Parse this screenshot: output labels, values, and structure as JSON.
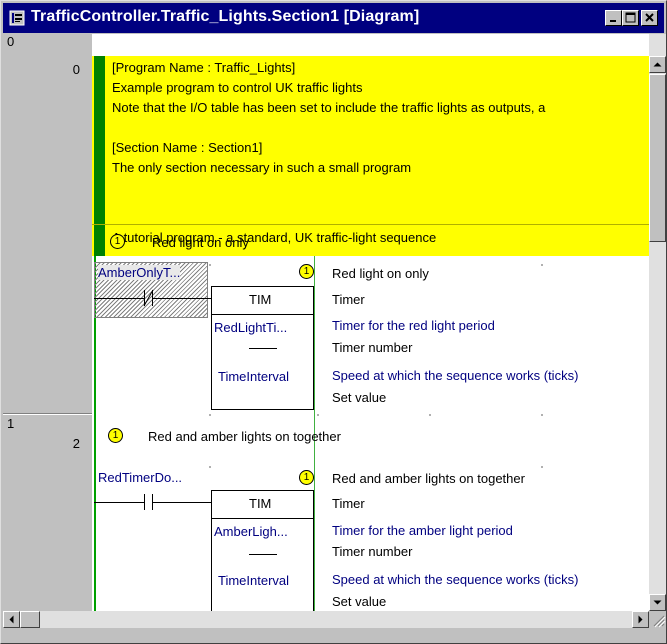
{
  "window": {
    "title": "TrafficController.Traffic_Lights.Section1 [Diagram]"
  },
  "rung_gutter": {
    "rungs": [
      {
        "rung": "0",
        "step": "0"
      },
      {
        "rung": "1",
        "step": "2"
      }
    ]
  },
  "comment_block": {
    "lines": [
      "[Program Name : Traffic_Lights]",
      "Example program to control UK traffic lights",
      "Note that the I/O table has been set to include the traffic lights as outputs, a",
      "",
      "[Section Name : Section1]",
      "The only section necessary in such a small program"
    ],
    "footer": "A tutorial program - a standard, UK traffic-light sequence"
  },
  "rung0": {
    "badge": "1",
    "comment": "Red light on only",
    "contact_name": "AmberOnlyT...",
    "block_type": "TIM",
    "operand1": "RedLightTi...",
    "operand2": "TimeInterval",
    "output_badge": "1",
    "descriptions": {
      "block_title": "Red light on only",
      "block_kind": "Timer",
      "operand1_comment": "Timer for the red light period",
      "operand1_label": "Timer number",
      "operand2_comment": "Speed at which the sequence works (ticks)",
      "operand2_label": "Set value"
    }
  },
  "rung1": {
    "badge": "1",
    "comment": "Red and amber lights on together",
    "contact_name": "RedTimerDo...",
    "block_type": "TIM",
    "operand1": "AmberLigh...",
    "operand2": "TimeInterval",
    "output_badge": "1",
    "descriptions": {
      "block_title": "Red and amber lights on together",
      "block_kind": "Timer",
      "operand1_comment": "Timer for the amber light period",
      "operand1_label": "Timer number",
      "operand2_comment": "Speed at which the sequence works (ticks)",
      "operand2_label": "Set value"
    }
  },
  "colors": {
    "titlebar": "#000080",
    "comment_bg": "#ffff00",
    "comment_bar": "#008000",
    "power_rail": "#00a000",
    "operand_comment": "#000080"
  },
  "icons": [
    "diagram-app-icon",
    "minimize-icon",
    "maximize-icon",
    "close-icon",
    "scroll-up-icon",
    "scroll-down-icon",
    "scroll-left-icon",
    "scroll-right-icon",
    "size-grip-icon"
  ]
}
